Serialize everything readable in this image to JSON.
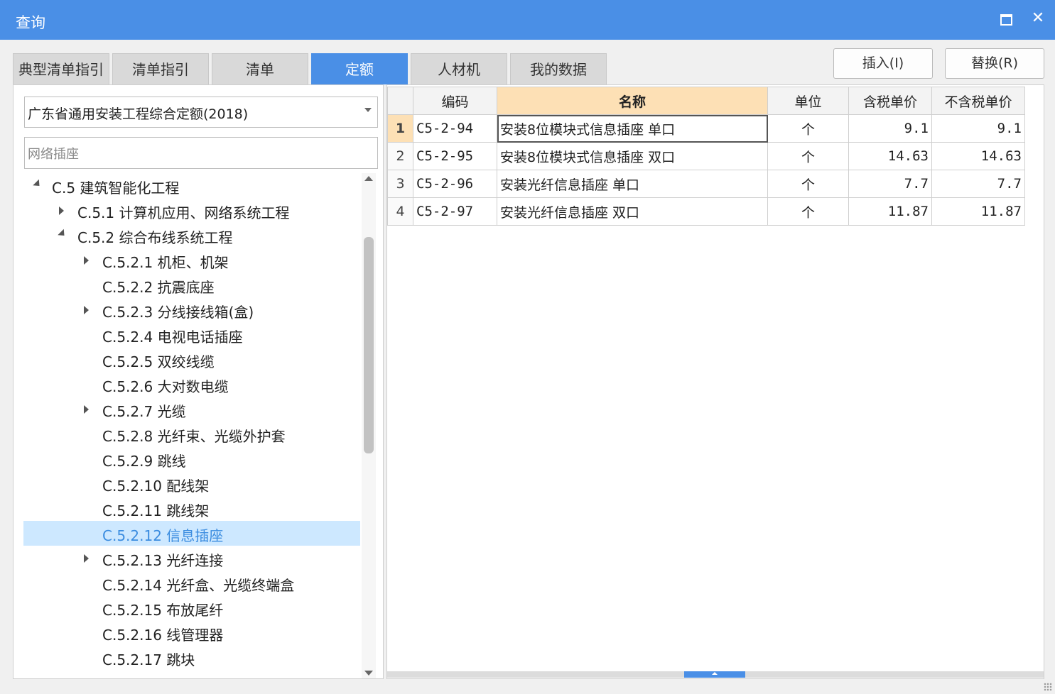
{
  "window": {
    "title": "查询",
    "close_glyph": "✕"
  },
  "tabs": [
    {
      "label": "典型清单指引",
      "active": false
    },
    {
      "label": "清单指引",
      "active": false
    },
    {
      "label": "清单",
      "active": false
    },
    {
      "label": "定额",
      "active": true
    },
    {
      "label": "人材机",
      "active": false
    },
    {
      "label": "我的数据",
      "active": false
    }
  ],
  "actions": {
    "insert_label": "插入(I)",
    "replace_label": "替换(R)"
  },
  "left": {
    "quota_library": "广东省通用安装工程综合定额(2018)",
    "search_value": "网络插座",
    "tree": [
      {
        "label": "C.5 建筑智能化工程",
        "level": 0,
        "expander": "expanded"
      },
      {
        "label": "C.5.1 计算机应用、网络系统工程",
        "level": 1,
        "expander": "collapsed"
      },
      {
        "label": "C.5.2 综合布线系统工程",
        "level": 1,
        "expander": "expanded"
      },
      {
        "label": "C.5.2.1 机柜、机架",
        "level": 2,
        "expander": "collapsed"
      },
      {
        "label": "C.5.2.2 抗震底座",
        "level": 2,
        "expander": "none"
      },
      {
        "label": "C.5.2.3 分线接线箱(盒)",
        "level": 2,
        "expander": "collapsed"
      },
      {
        "label": "C.5.2.4 电视电话插座",
        "level": 2,
        "expander": "none"
      },
      {
        "label": "C.5.2.5 双绞线缆",
        "level": 2,
        "expander": "none"
      },
      {
        "label": "C.5.2.6 大对数电缆",
        "level": 2,
        "expander": "none"
      },
      {
        "label": "C.5.2.7 光缆",
        "level": 2,
        "expander": "collapsed"
      },
      {
        "label": "C.5.2.8 光纤束、光缆外护套",
        "level": 2,
        "expander": "none"
      },
      {
        "label": "C.5.2.9 跳线",
        "level": 2,
        "expander": "none"
      },
      {
        "label": "C.5.2.10 配线架",
        "level": 2,
        "expander": "none"
      },
      {
        "label": "C.5.2.11 跳线架",
        "level": 2,
        "expander": "none"
      },
      {
        "label": "C.5.2.12 信息插座",
        "level": 2,
        "expander": "none",
        "selected": true
      },
      {
        "label": "C.5.2.13 光纤连接",
        "level": 2,
        "expander": "collapsed"
      },
      {
        "label": "C.5.2.14 光纤盒、光缆终端盒",
        "level": 2,
        "expander": "none"
      },
      {
        "label": "C.5.2.15 布放尾纤",
        "level": 2,
        "expander": "none"
      },
      {
        "label": "C.5.2.16 线管理器",
        "level": 2,
        "expander": "none"
      },
      {
        "label": "C.5.2.17 跳块",
        "level": 2,
        "expander": "none"
      }
    ]
  },
  "grid": {
    "columns": [
      "编码",
      "名称",
      "单位",
      "含税单价",
      "不含税单价"
    ],
    "rows": [
      {
        "num": "1",
        "code": "C5-2-94",
        "name": "安装8位模块式信息插座 单口",
        "unit": "个",
        "price_tax": "9.1",
        "price_notax": "9.1"
      },
      {
        "num": "2",
        "code": "C5-2-95",
        "name": "安装8位模块式信息插座 双口",
        "unit": "个",
        "price_tax": "14.63",
        "price_notax": "14.63"
      },
      {
        "num": "3",
        "code": "C5-2-96",
        "name": "安装光纤信息插座 单口",
        "unit": "个",
        "price_tax": "7.7",
        "price_notax": "7.7"
      },
      {
        "num": "4",
        "code": "C5-2-97",
        "name": "安装光纤信息插座 双口",
        "unit": "个",
        "price_tax": "11.87",
        "price_notax": "11.87"
      }
    ]
  }
}
